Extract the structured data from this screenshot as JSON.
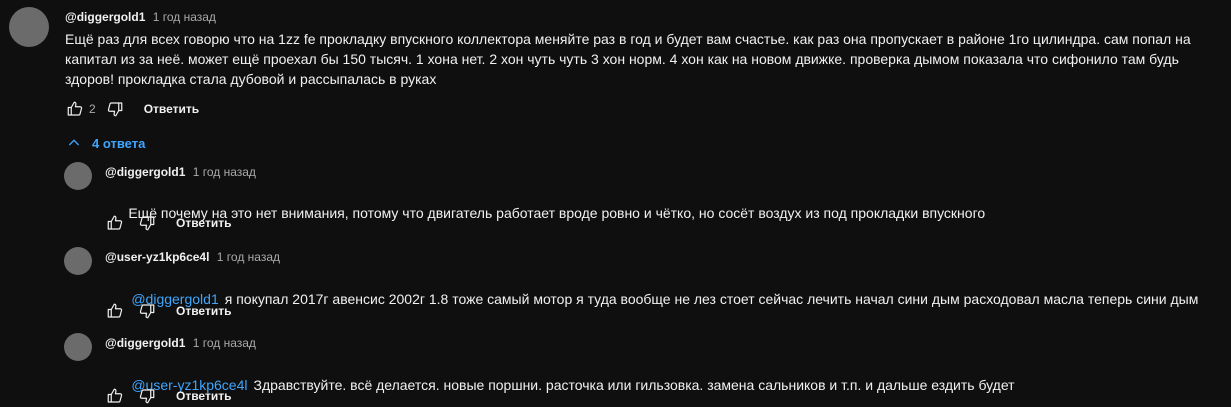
{
  "top_comment": {
    "author": "@diggergold1",
    "time": "1 год назад",
    "text": "Ещё раз для всех говорю что на 1zz fe прокладку впускного коллектора меняйте раз в год и будет вам счастье. как раз она пропускает в районе 1го цилиндра. сам попал на капитал из за неё. может ещё проехал бы 150 тысяч. 1 хона нет. 2 хон чуть чуть 3 хон норм. 4 хон как на новом движке. проверка дымом показала что сифонило там будь здоров! прокладка стала дубовой и рассыпалась в руках",
    "likes": "2",
    "reply_label": "Ответить"
  },
  "replies_toggle": {
    "label": "4 ответа",
    "icon": "chevron-up-icon"
  },
  "replies": [
    {
      "author": "@diggergold1",
      "time": "1 год назад",
      "mention": "",
      "text": "Ещё почему на это нет внимания, потому что двигатель работает вроде ровно и чётко, но сосёт воздух из под прокладки впускного",
      "reply_label": "Ответить"
    },
    {
      "author": "@user-yz1kp6ce4l",
      "time": "1 год назад",
      "mention": "@diggergold1",
      "text": "я покупал 2017г авенсис 2002г 1.8 тоже самый мотор я туда вообще не лез стоет сейчас лечить начал сини дым расходовал масла теперь сини дым",
      "reply_label": "Ответить"
    },
    {
      "author": "@diggergold1",
      "time": "1 год назад",
      "mention": "@user-yz1kp6ce4l",
      "text": "Здравствуйте. всё делается. новые поршни. расточка или гильзовка. замена сальников и т.п. и дальше ездить будет",
      "reply_label": "Ответить"
    }
  ],
  "colors": {
    "background": "#0f0f0f",
    "text": "#f1f1f1",
    "secondary_text": "#aaaaaa",
    "link": "#3ea6ff",
    "avatar": "#6b6b6b"
  }
}
